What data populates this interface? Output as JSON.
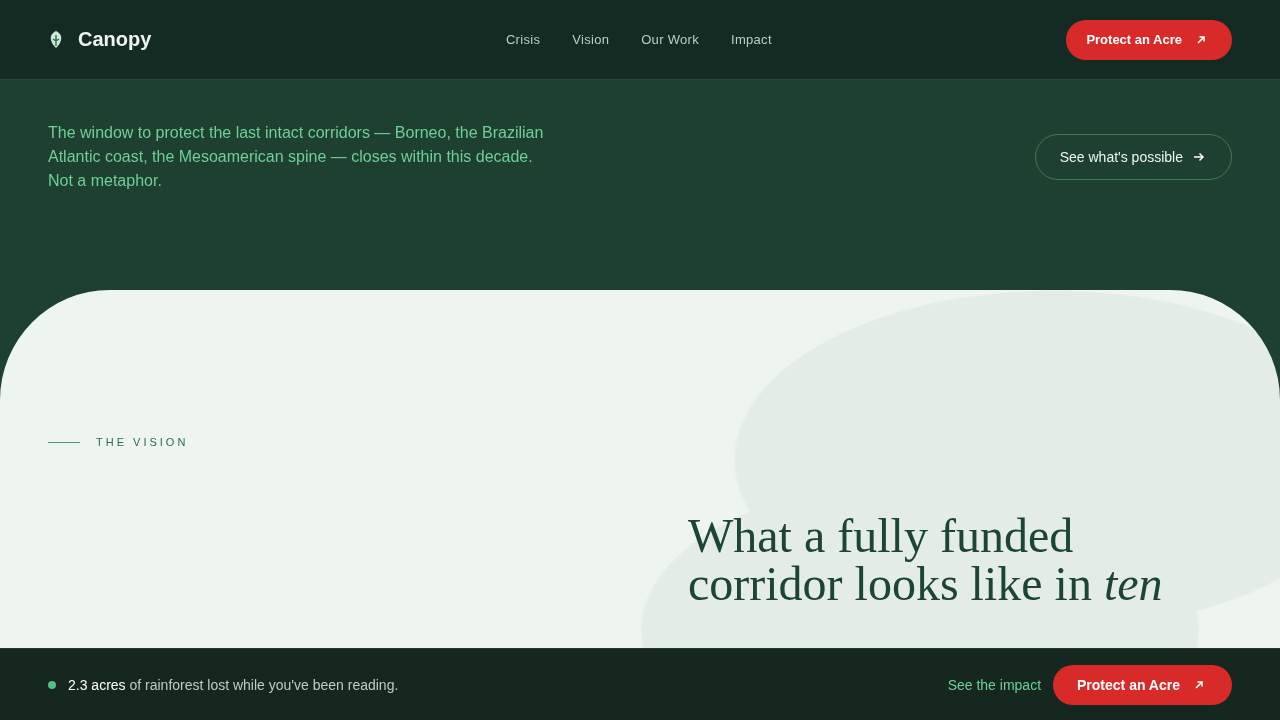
{
  "header": {
    "brand": "Canopy",
    "nav": [
      {
        "label": "Crisis"
      },
      {
        "label": "Vision"
      },
      {
        "label": "Our Work"
      },
      {
        "label": "Impact"
      }
    ],
    "cta": "Protect an Acre"
  },
  "hero": {
    "text": "The window to protect the last intact corridors — Borneo, the Brazilian Atlantic coast, the Mesoamerican spine — closes within this decade. Not a metaphor.",
    "button": "See what's possible"
  },
  "vision": {
    "eyebrow": "THE VISION",
    "heading": "What a fully funded corridor looks like in *ten*"
  },
  "ticker": {
    "message": "**2.3 acres** of rainforest lost while you've been reading.",
    "link": "See the impact",
    "cta": "Protect an Acre"
  }
}
